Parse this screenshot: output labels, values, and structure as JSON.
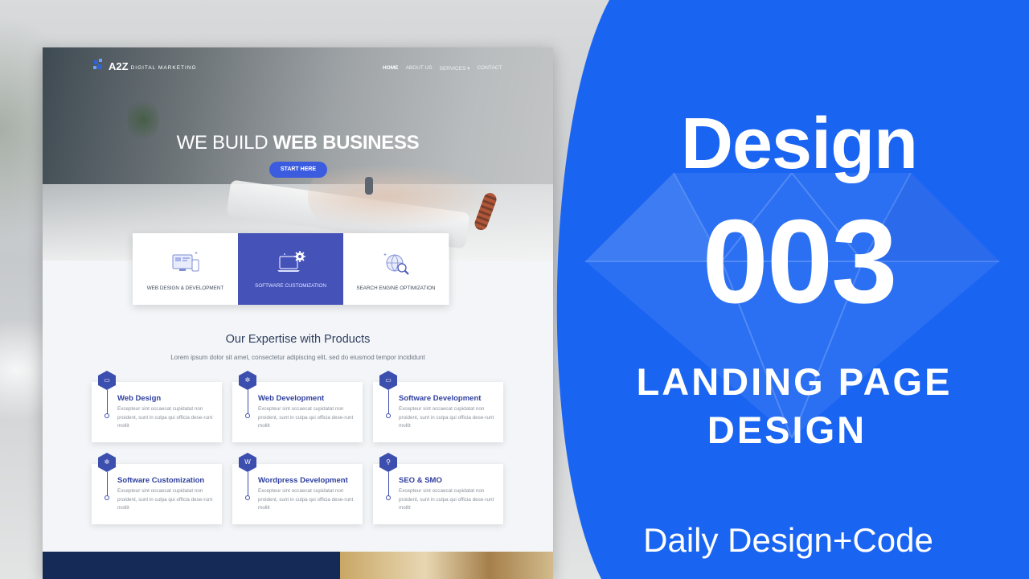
{
  "mockup": {
    "logo": {
      "mark_text": "A2Z",
      "tagline": "DIGITAL MARKETING"
    },
    "nav": [
      {
        "label": "HOME",
        "active": true
      },
      {
        "label": "ABOUT US"
      },
      {
        "label": "SERVICES ▾"
      },
      {
        "label": "CONTACT"
      }
    ],
    "hero": {
      "title_light": "WE BUILD ",
      "title_bold": "WEB BUSINESS",
      "cta": "START HERE"
    },
    "features": [
      {
        "label": "WEB DESIGN & DEVELOPMENT",
        "icon": "devices-icon"
      },
      {
        "label": "SOFTWARE CUSTOMIZATION",
        "icon": "laptop-gear-icon",
        "active": true
      },
      {
        "label": "SEARCH ENGINE OPTIMIZATION",
        "icon": "globe-search-icon"
      }
    ],
    "expertise": {
      "title": "Our Expertise with Products",
      "subtitle": "Lorem ipsum dolor sit amet, consectetur adipiscing elit, sed do eiusmod tempor incididunt"
    },
    "services": [
      {
        "title": "Web Design",
        "icon": "monitor-icon",
        "glyph": "▭",
        "desc": "Excepteur sint occaecat cupidatat non proident, sunt in culpa qui officia dese-runt mollit"
      },
      {
        "title": "Web Development",
        "icon": "gear-icon",
        "glyph": "✲",
        "desc": "Excepteur sint occaecat cupidatat non proident, sunt in culpa qui officia dese-runt mollit"
      },
      {
        "title": "Software Development",
        "icon": "laptop-icon",
        "glyph": "▭",
        "desc": "Excepteur sint occaecat cupidatat non proident, sunt in culpa qui officia dese-runt mollit"
      },
      {
        "title": "Software Customization",
        "icon": "cog-icon",
        "glyph": "✲",
        "desc": "Excepteur sint occaecat cupidatat non proident, sunt in culpa qui officia dese-runt mollit"
      },
      {
        "title": "Wordpress Development",
        "icon": "wordpress-icon",
        "glyph": "W",
        "desc": "Excepteur sint occaecat cupidatat non proident, sunt in culpa qui officia dese-runt mollit"
      },
      {
        "title": "SEO & SMO",
        "icon": "search-icon",
        "glyph": "⚲",
        "desc": "Excepteur sint occaecat cupidatat non proident, sunt in culpa qui officia dese-runt mollit"
      }
    ]
  },
  "promo": {
    "design": "Design",
    "number": "003",
    "line1": "LANDING PAGE",
    "line2": "DESIGN",
    "tagline": "Daily Design+Code"
  },
  "colors": {
    "accent": "#3c5ce0",
    "card_active": "#4553b9",
    "promo_blue": "#1a64f2",
    "service_title": "#2f3f9e"
  }
}
